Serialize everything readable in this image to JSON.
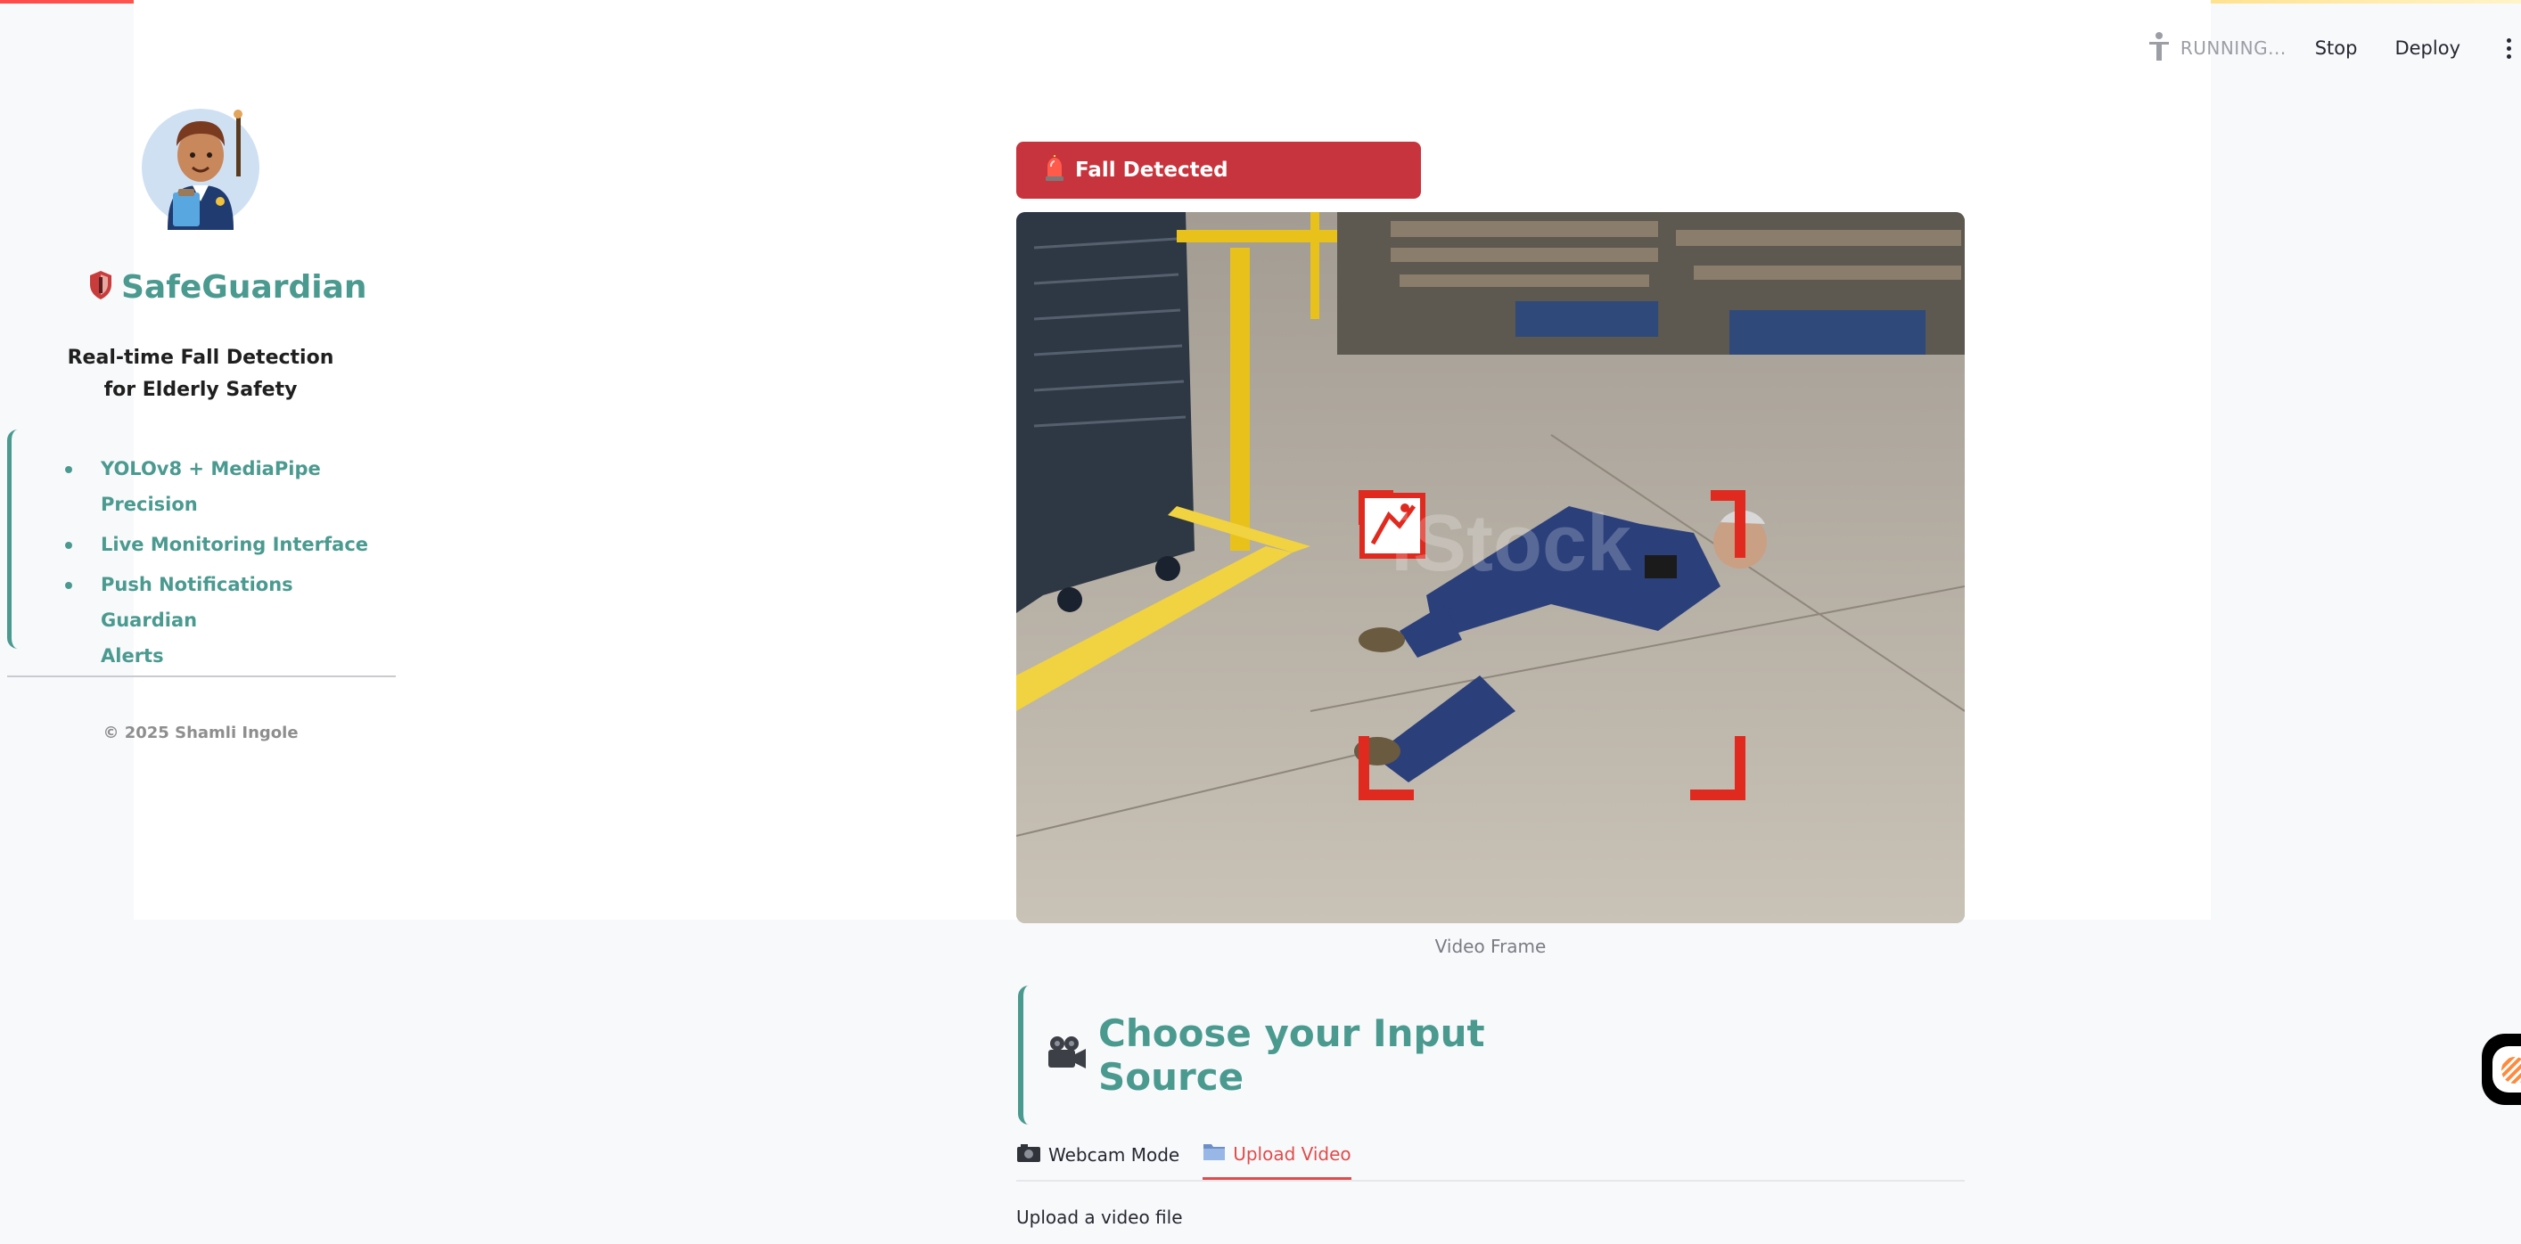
{
  "header": {
    "status": "RUNNING...",
    "stop_label": "Stop",
    "deploy_label": "Deploy",
    "status_icon": "running-person-icon",
    "menu_icon": "kebab-menu-icon"
  },
  "sidebar": {
    "app_name": "SafeGuardian",
    "brand_icon": "shield-icon",
    "tagline_line1": "Real-time Fall Detection",
    "tagline_line2": "for Elderly Safety",
    "features": [
      {
        "label": "YOLOv8 + MediaPipe Precision"
      },
      {
        "label": "Live Monitoring Interface"
      },
      {
        "label_line1": "Push Notifications Guardian",
        "label_line2": "Alerts"
      }
    ],
    "copyright": "© 2025 Shamli Ingole"
  },
  "main": {
    "alert": {
      "text": "Fall Detected",
      "icon": "siren-icon",
      "color": "#c7343d"
    },
    "frame_caption": "Video Frame",
    "section_title": "Choose your Input Source",
    "section_icon": "movie-camera-icon",
    "tabs": [
      {
        "label": "Webcam Mode",
        "icon": "camera-icon",
        "active": false
      },
      {
        "label": "Upload Video",
        "icon": "folder-icon",
        "active": true
      }
    ],
    "upload_label": "Upload a video file"
  },
  "colors": {
    "accent": "#4a9a90",
    "alert": "#c7343d",
    "active_tab": "#e04c4c"
  }
}
